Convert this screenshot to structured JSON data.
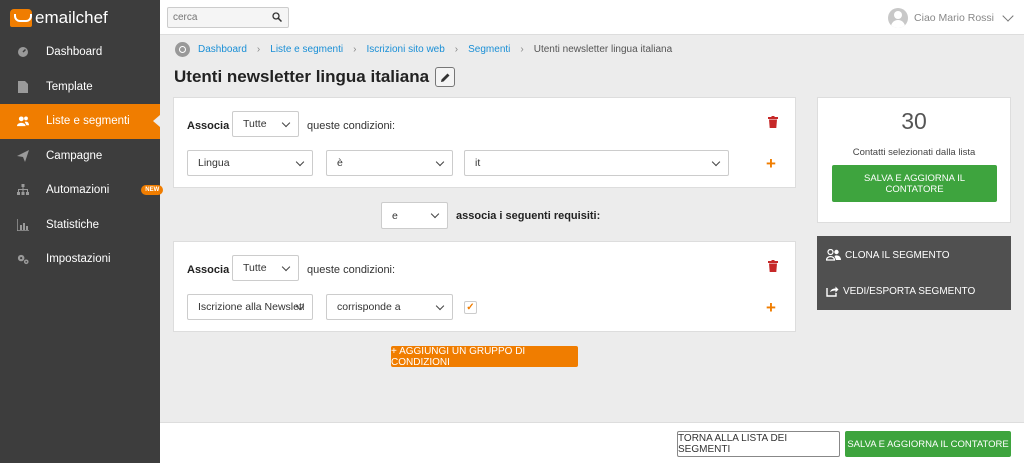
{
  "app": {
    "name": "emailchef"
  },
  "sidebar": {
    "items": [
      {
        "label": "Dashboard",
        "icon": "dashboard-icon",
        "active": false
      },
      {
        "label": "Template",
        "icon": "document-icon",
        "active": false
      },
      {
        "label": "Liste e segmenti",
        "icon": "users-icon",
        "active": true
      },
      {
        "label": "Campagne",
        "icon": "paper-plane-icon",
        "active": false
      },
      {
        "label": "Automazioni",
        "icon": "sitemap-icon",
        "active": false,
        "badge": "NEW"
      },
      {
        "label": "Statistiche",
        "icon": "bar-chart-icon",
        "active": false
      },
      {
        "label": "Impostazioni",
        "icon": "gears-icon",
        "active": false
      }
    ]
  },
  "topbar": {
    "search_placeholder": "cerca",
    "user_name": "Ciao Mario Rossi"
  },
  "breadcrumb": {
    "items": [
      "Dashboard",
      "Liste e segmenti",
      "Iscrizioni sito web",
      "Segmenti"
    ],
    "current": "Utenti newsletter lingua italiana"
  },
  "page": {
    "title": "Utenti newsletter lingua italiana"
  },
  "groups": [
    {
      "associa_label": "Associa",
      "match_value": "Tutte",
      "conditions_label": "queste condizioni:",
      "condition": {
        "field": "Lingua",
        "operator": "è",
        "value": "it"
      }
    },
    {
      "associa_label": "Associa",
      "match_value": "Tutte",
      "conditions_label": "queste condizioni:",
      "condition": {
        "field": "Iscrizione alla Newslette",
        "operator": "corrisponde a",
        "checked": true
      }
    }
  ],
  "connector": {
    "value": "e",
    "label": "associa i seguenti requisiti:"
  },
  "add_group_button": "+ AGGIUNGI UN GRUPPO DI CONDIZIONI",
  "counter": {
    "value": "30",
    "label": "Contatti selezionati dalla lista",
    "save_button_line1": "SALVA E AGGIORNA IL",
    "save_button_line2": "CONTATORE"
  },
  "actions": {
    "clone": "CLONA IL SEGMENTO",
    "export": "VEDI/ESPORTA SEGMENTO"
  },
  "footer": {
    "back_button": "TORNA ALLA LISTA DEI SEGMENTI",
    "save_button": "SALVA E AGGIORNA IL CONTATORE"
  },
  "colors": {
    "accent": "#f07d00",
    "green": "#3ea43e",
    "sidebar": "#3d3d3d",
    "link": "#1a8fd6"
  }
}
